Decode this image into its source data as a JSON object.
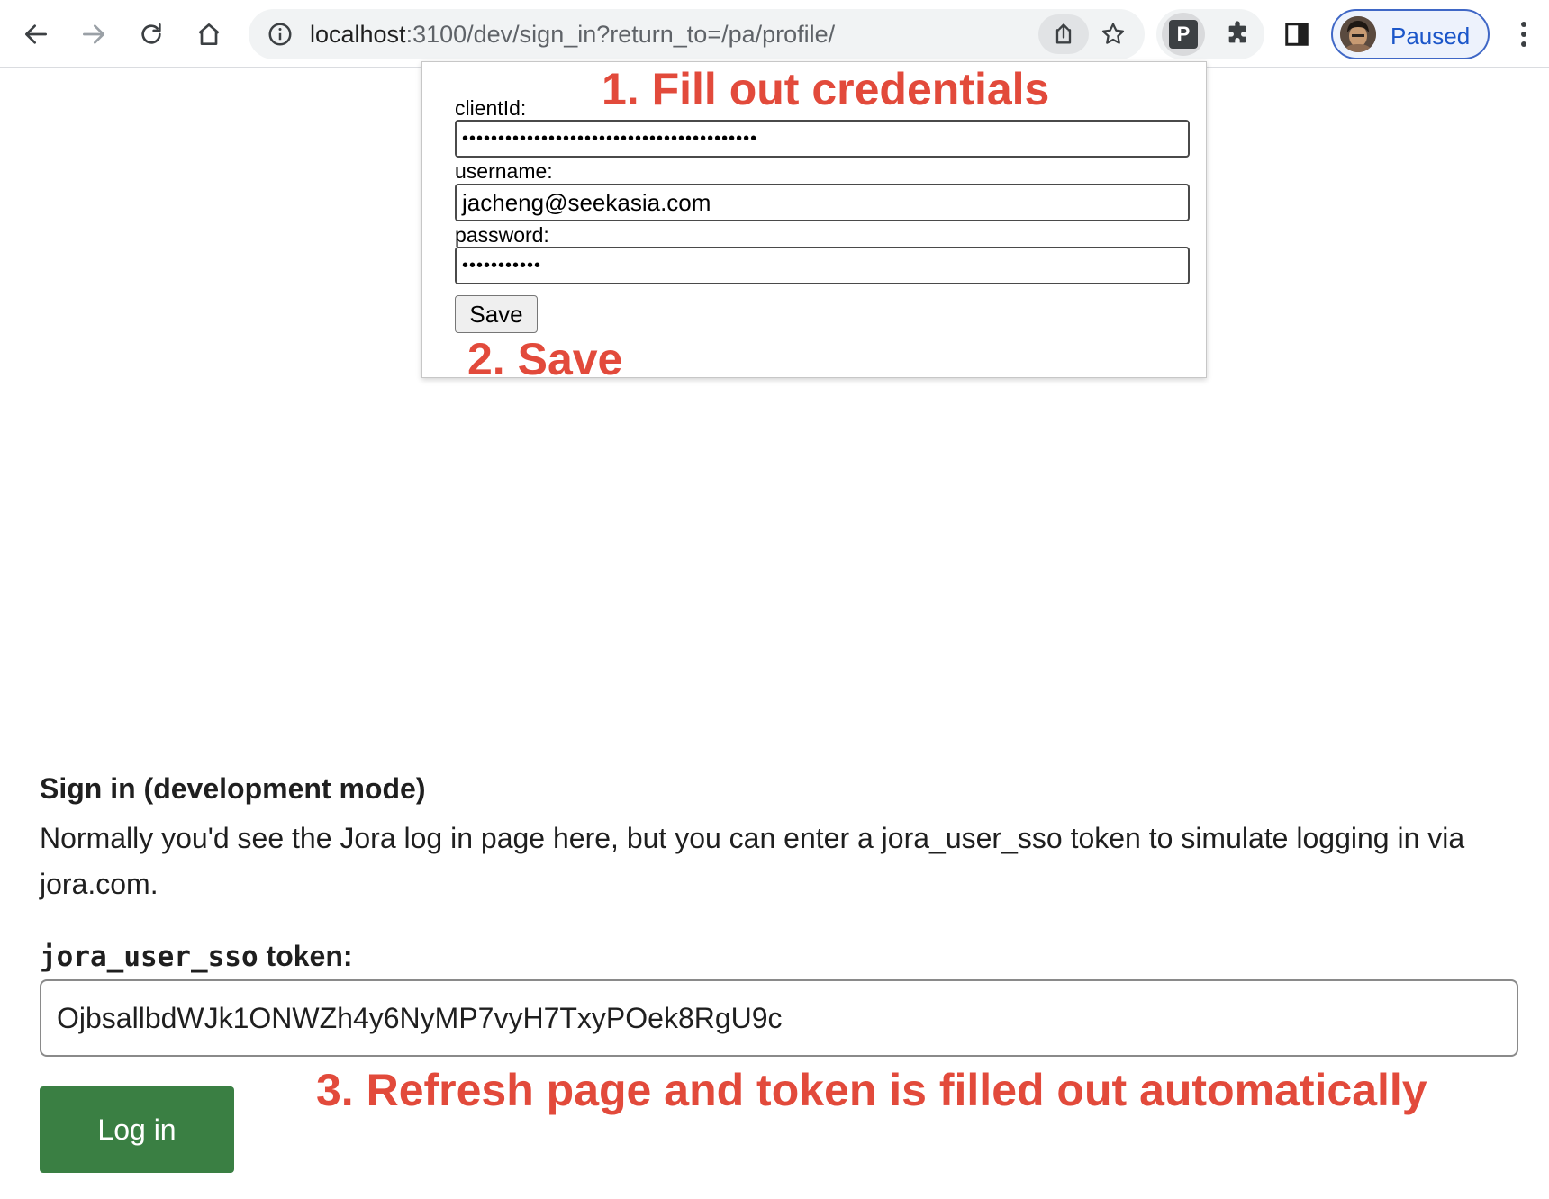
{
  "browser": {
    "url_host": "localhost",
    "url_rest": ":3100/dev/sign_in?return_to=/pa/profile/",
    "extension_letter": "P",
    "profile_status": "Paused"
  },
  "popup": {
    "client_id_label": "clientId:",
    "client_id_value": "•••••••••••••••••••••••••••••••••••••••••",
    "username_label": "username:",
    "username_value": "jacheng@seekasia.com",
    "password_label": "password:",
    "password_value": "•••••••••••",
    "save_label": "Save"
  },
  "annotations": {
    "step1": "1. Fill out credentials",
    "step2": "2. Save",
    "step3": "3. Refresh page and token is filled out automatically"
  },
  "page": {
    "heading": "Sign in (development mode)",
    "description": "Normally you'd see the Jora log in page here, but you can enter a jora_user_sso token to simulate logging in via jora.com.",
    "token_label_code": "jora_user_sso",
    "token_label_rest": " token:",
    "token_value": "OjbsallbdWJk1ONWZh4y6NyMP7vyH7TxyPOek8RgU9c",
    "login_label": "Log in"
  },
  "colors": {
    "annotation": "#e24a3b",
    "login_button": "#3a7f43",
    "profile_accent": "#1b56c9"
  }
}
